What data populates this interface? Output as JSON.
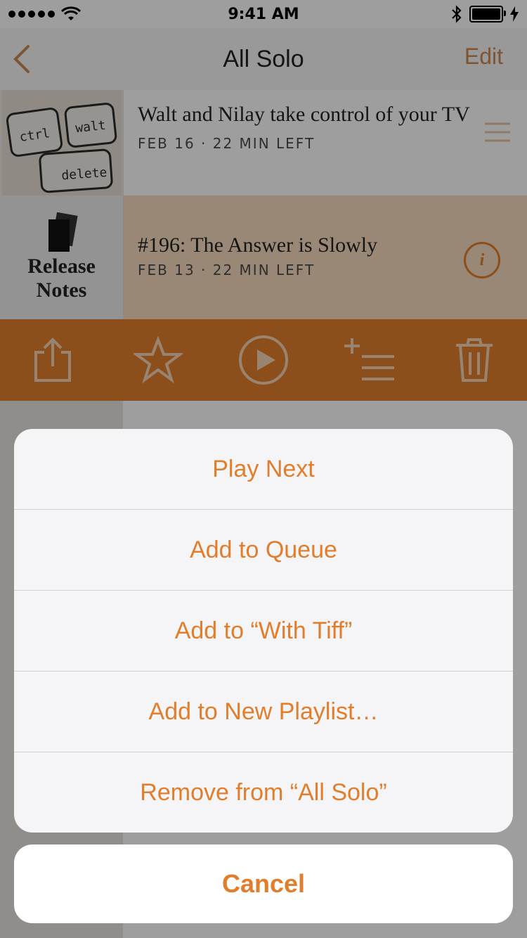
{
  "status": {
    "time": "9:41 AM"
  },
  "nav": {
    "title": "All Solo",
    "edit": "Edit"
  },
  "episodes": [
    {
      "title": "Walt and Nilay take control of your TV",
      "meta": "FEB 16 · 22 MIN LEFT",
      "art_keys": [
        "ctrl",
        "walt",
        "delete"
      ]
    },
    {
      "title": "#196: The Answer is Slowly",
      "meta": "FEB 13 · 22 MIN LEFT",
      "art_label_1": "Release",
      "art_label_2": "Notes"
    }
  ],
  "actions": [
    "share-icon",
    "star-icon",
    "play-icon",
    "add-to-queue-icon",
    "trash-icon"
  ],
  "sheet": {
    "items": [
      "Play Next",
      "Add to Queue",
      "Add to “With Tiff”",
      "Add to New Playlist…",
      "Remove from “All Solo”"
    ],
    "cancel": "Cancel"
  },
  "colors": {
    "accent": "#e27e2b",
    "selected_row": "#f7dbbf"
  }
}
